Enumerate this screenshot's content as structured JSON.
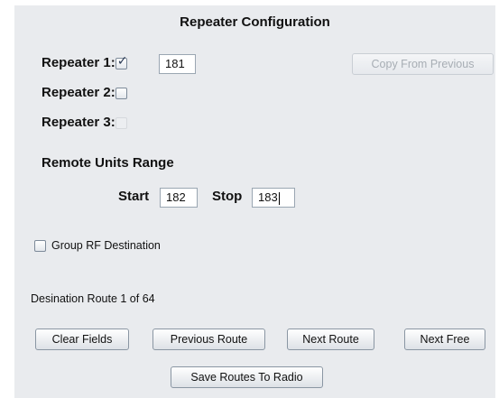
{
  "title": "Repeater Configuration",
  "repeaters": [
    {
      "label": "Repeater 1:",
      "checked": true,
      "enabled": true,
      "value": "181"
    },
    {
      "label": "Repeater 2:",
      "checked": false,
      "enabled": true
    },
    {
      "label": "Repeater 3:",
      "checked": false,
      "enabled": false
    }
  ],
  "copy_button": "Copy From Previous",
  "remote_range": {
    "heading": "Remote Units Range",
    "start_label": "Start",
    "start_value": "182",
    "stop_label": "Stop",
    "stop_value": "183"
  },
  "group_rf": {
    "label": "Group RF Destination",
    "checked": false
  },
  "route_status": "Desination Route 1 of 64",
  "buttons": {
    "clear": "Clear Fields",
    "previous": "Previous Route",
    "next": "Next Route",
    "next_free": "Next Free",
    "save": "Save Routes To Radio"
  }
}
